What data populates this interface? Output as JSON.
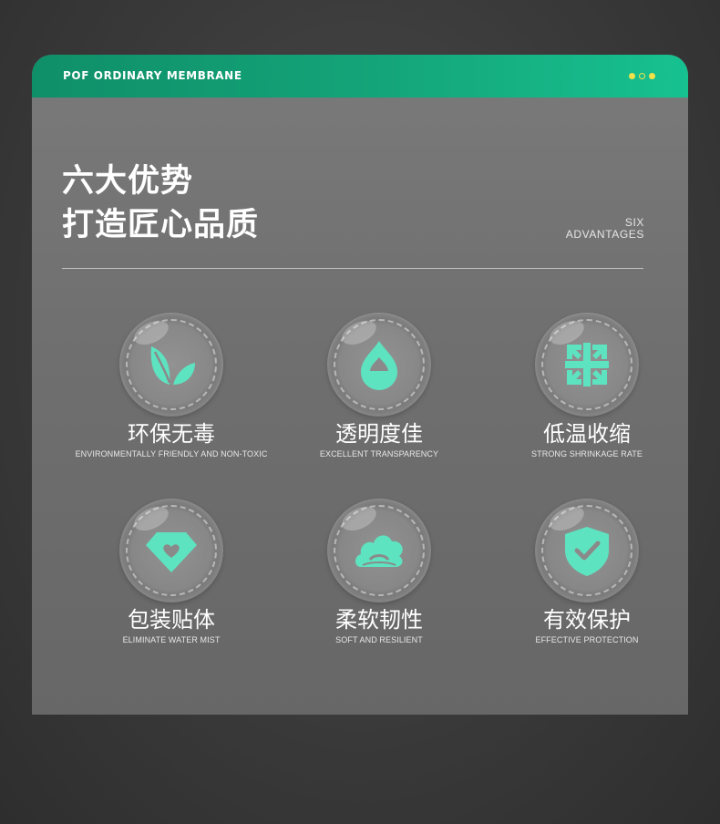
{
  "header": {
    "title": "POF ORDINARY MEMBRANE"
  },
  "colors": {
    "accent": "#5ee3c0",
    "header_start": "#0f8f68",
    "header_end": "#17c190",
    "dots": "#f2e14a"
  },
  "headline": {
    "line1": "六大优势",
    "line2": "打造匠心品质"
  },
  "side_label": {
    "line1": "SIX",
    "line2": "ADVANTAGES"
  },
  "features": [
    {
      "title": "环保无毒",
      "subtitle": "ENVIRONMENTALLY FRIENDLY AND NON-TOXIC",
      "icon": "leaf-icon"
    },
    {
      "title": "透明度佳",
      "subtitle": "EXCELLENT TRANSPARENCY",
      "icon": "water-drop-icon"
    },
    {
      "title": "低温收缩",
      "subtitle": "STRONG SHRINKAGE RATE",
      "icon": "shrink-arrows-icon"
    },
    {
      "title": "包装贴体",
      "subtitle": "ELIMINATE WATER MIST",
      "icon": "diamond-heart-icon"
    },
    {
      "title": "柔软韧性",
      "subtitle": "SOFT AND RESILIENT",
      "icon": "cloud-icon"
    },
    {
      "title": "有效保护",
      "subtitle": "EFFECTIVE PROTECTION",
      "icon": "shield-check-icon"
    }
  ]
}
